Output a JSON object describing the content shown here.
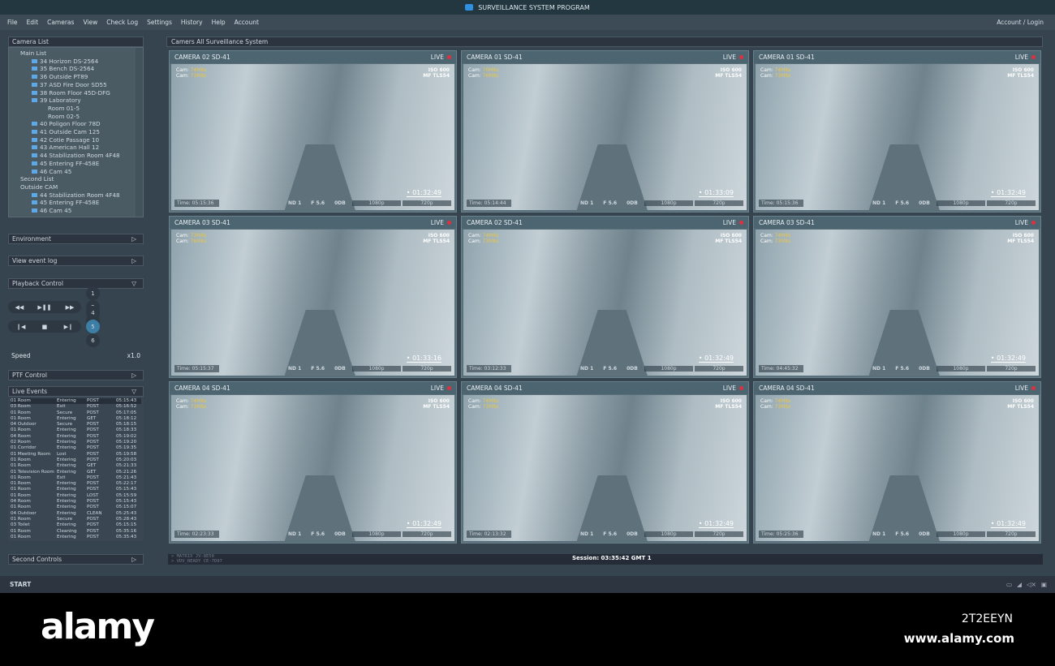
{
  "title": "SURVEILLANCE SYSTEM PROGRAM",
  "menu": [
    "File",
    "Edit",
    "Cameras",
    "View",
    "Check Log",
    "Settings",
    "History",
    "Help",
    "Account"
  ],
  "account_login": "Account / Login",
  "camera_list": {
    "title": "Camera List",
    "items": [
      {
        "t": "Main List",
        "k": "g"
      },
      {
        "t": "34 Horizon DS-2564",
        "k": "c"
      },
      {
        "t": "35 Bench DS-2564",
        "k": "c"
      },
      {
        "t": "36 Outside PT89",
        "k": "c"
      },
      {
        "t": "37 ASD Fire Door SD55",
        "k": "c"
      },
      {
        "t": "38 Room Floor 45D-DFG",
        "k": "c"
      },
      {
        "t": "39 Laboratory",
        "k": "c"
      },
      {
        "t": "Room 01-5",
        "k": "cc"
      },
      {
        "t": "Room 02-5",
        "k": "cc"
      },
      {
        "t": "40 Poligon Floor 78D",
        "k": "c"
      },
      {
        "t": "41 Outside Cam 125",
        "k": "c"
      },
      {
        "t": "42 Cotie Passage 10",
        "k": "c"
      },
      {
        "t": "43 American Hall 12",
        "k": "c"
      },
      {
        "t": "44 Stabilization Room 4F48",
        "k": "c"
      },
      {
        "t": "45 Entering FF-458E",
        "k": "c"
      },
      {
        "t": "46 Cam 45",
        "k": "c"
      },
      {
        "t": "Second List",
        "k": "g"
      },
      {
        "t": "Outside CAM",
        "k": "g"
      },
      {
        "t": "44 Stabilization Room 4F48",
        "k": "c"
      },
      {
        "t": "45 Entering FF-458E",
        "k": "c"
      },
      {
        "t": "46 Cam 45",
        "k": "c"
      }
    ]
  },
  "panels": {
    "environment": "Environment",
    "event_log": "View event log",
    "playback": "Playback Control",
    "speed_label": "Speed",
    "speed_value": "x1.0",
    "ptf": "PTF Control",
    "live_events": "Live Events",
    "second_controls": "Second Controls"
  },
  "playback_numbers": [
    "1",
    "2",
    "3",
    "4",
    "5",
    "6"
  ],
  "playback_selected": "5",
  "events": [
    [
      "01 Room",
      "Entering",
      "POST",
      "05:15:43"
    ],
    [
      "03 Room",
      "Exit",
      "POST",
      "05:16:52"
    ],
    [
      "01 Room",
      "Secure",
      "POST",
      "05:17:05"
    ],
    [
      "01 Room",
      "Entering",
      "GET",
      "05:18:12"
    ],
    [
      "04 Outdoor",
      "Secure",
      "POST",
      "05:18:15"
    ],
    [
      "01 Room",
      "Entering",
      "POST",
      "05:18:33"
    ],
    [
      "04 Room",
      "Entering",
      "POST",
      "05:19:02"
    ],
    [
      "02 Room",
      "Entering",
      "POST",
      "05:19:20"
    ],
    [
      "01 Corridor",
      "Entering",
      "POST",
      "05:19:35"
    ],
    [
      "01 Meeting Room",
      "Lost",
      "POST",
      "05:19:58"
    ],
    [
      "01 Room",
      "Entering",
      "POST",
      "05:20:03"
    ],
    [
      "01 Room",
      "Entering",
      "GET",
      "05:21:33"
    ],
    [
      "01 Television Room",
      "Entering",
      "GET",
      "05:21:26"
    ],
    [
      "01 Room",
      "Exit",
      "POST",
      "05:21:43"
    ],
    [
      "01 Room",
      "Entering",
      "POST",
      "05:22:17"
    ],
    [
      "01 Room",
      "Entering",
      "POST",
      "05:15:43"
    ],
    [
      "01 Room",
      "Entering",
      "LOST",
      "05:15:59"
    ],
    [
      "04 Room",
      "Entering",
      "POST",
      "05:15:43"
    ],
    [
      "01 Room",
      "Entering",
      "POST",
      "05:15:07"
    ],
    [
      "04 Outdoor",
      "Entering",
      "CLEAN",
      "05:25:43"
    ],
    [
      "01 Room",
      "Secure",
      "POST",
      "05:28:43"
    ],
    [
      "03 Toilet",
      "Entering",
      "POST",
      "05:15:15"
    ],
    [
      "01 Room",
      "Cleaning",
      "POST",
      "05:35:16"
    ],
    [
      "01 Room",
      "Entering",
      "POST",
      "05:35:43"
    ]
  ],
  "grid_title": "Camers All Surveillance System",
  "cameras": [
    {
      "name": "CAMERA 02 SD-41",
      "c1": "74Mbs",
      "c2": "73Mbs",
      "time": "Time: 05:15:36",
      "rec": "01:32:49"
    },
    {
      "name": "CAMERA 01 SD-41",
      "c1": "70Mbs",
      "c2": "76Mbs",
      "time": "Time: 05:14:44",
      "rec": "01:33:09"
    },
    {
      "name": "CAMERA 01 SD-41",
      "c1": "74Mbs",
      "c2": "73Mbs",
      "time": "Time: 05:15:36",
      "rec": "01:32:49"
    },
    {
      "name": "CAMERA 03 SD-41",
      "c1": "73Mbs",
      "c2": "76Mbs",
      "time": "Time: 05:15:37",
      "rec": "01:33:16"
    },
    {
      "name": "CAMERA 02 SD-41",
      "c1": "74Mbs",
      "c2": "73Mbs",
      "time": "Time: 03:12:33",
      "rec": "01:32:49"
    },
    {
      "name": "CAMERA 03 SD-41",
      "c1": "74Mbs",
      "c2": "73Mbs",
      "time": "Time: 04:45:32",
      "rec": "01:32:49"
    },
    {
      "name": "CAMERA 04 SD-41",
      "c1": "74Mbs",
      "c2": "73Mbs",
      "time": "Time: 02:23:33",
      "rec": "01:32:49"
    },
    {
      "name": "CAMERA 04 SD-41",
      "c1": "74Mbs",
      "c2": "73Mbs",
      "time": "Time: 02:13:32",
      "rec": "01:32:49"
    },
    {
      "name": "CAMERA 04 SD-41",
      "c1": "74Mbs",
      "c2": "73Mbs",
      "time": "Time: 05:25:36",
      "rec": "01:32:49"
    }
  ],
  "cam_common": {
    "live": "LIVE",
    "cam": "Cam:",
    "iso": "ISO 600",
    "mf": "MF TLS54",
    "nd": "ND 1",
    "f": "F 5.6",
    "db": "0DB",
    "r1": "1080p",
    "r2": "720p"
  },
  "status": {
    "l1": "> MATRIX        JV-8E50",
    "l2": "> VDV_READY     CE-7D97",
    "session": "Session: 03:35:42 GMT 1"
  },
  "taskbar": {
    "start": "START"
  },
  "footer": {
    "logo": "alamy",
    "id": "2T2EEYN",
    "url": "www.alamy.com"
  }
}
